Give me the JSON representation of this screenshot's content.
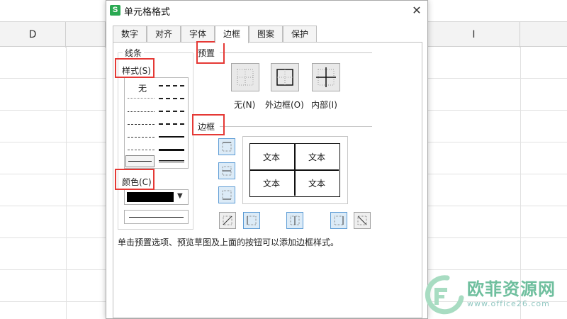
{
  "spreadsheet": {
    "columns": [
      "D",
      "I"
    ]
  },
  "dialog": {
    "title": "单元格格式",
    "app_icon": "S",
    "close_symbol": "✕",
    "tabs": [
      {
        "label": "数字"
      },
      {
        "label": "对齐"
      },
      {
        "label": "字体"
      },
      {
        "label": "边框",
        "active": true
      },
      {
        "label": "图案"
      },
      {
        "label": "保护"
      }
    ]
  },
  "line_section": {
    "title": "线条",
    "style_label": "样式(S)",
    "style_none": "无",
    "color_label": "颜色(C)",
    "selected_color": "#000000"
  },
  "preset_section": {
    "title": "预置",
    "none_label": "无(N)",
    "outline_label": "外边框(O)",
    "inside_label": "内部(I)"
  },
  "border_section": {
    "title": "边框",
    "cell_text": [
      "文本",
      "文本",
      "文本",
      "文本"
    ]
  },
  "hint": "单击预置选项、预览草图及上面的按钮可以添加边框样式。",
  "watermark": {
    "name": "欧菲资源网",
    "url": "www.office26.com"
  },
  "colors": {
    "highlight_red": "#e53935",
    "accent_blue": "#5b9bd5",
    "app_green": "#2aa952"
  }
}
